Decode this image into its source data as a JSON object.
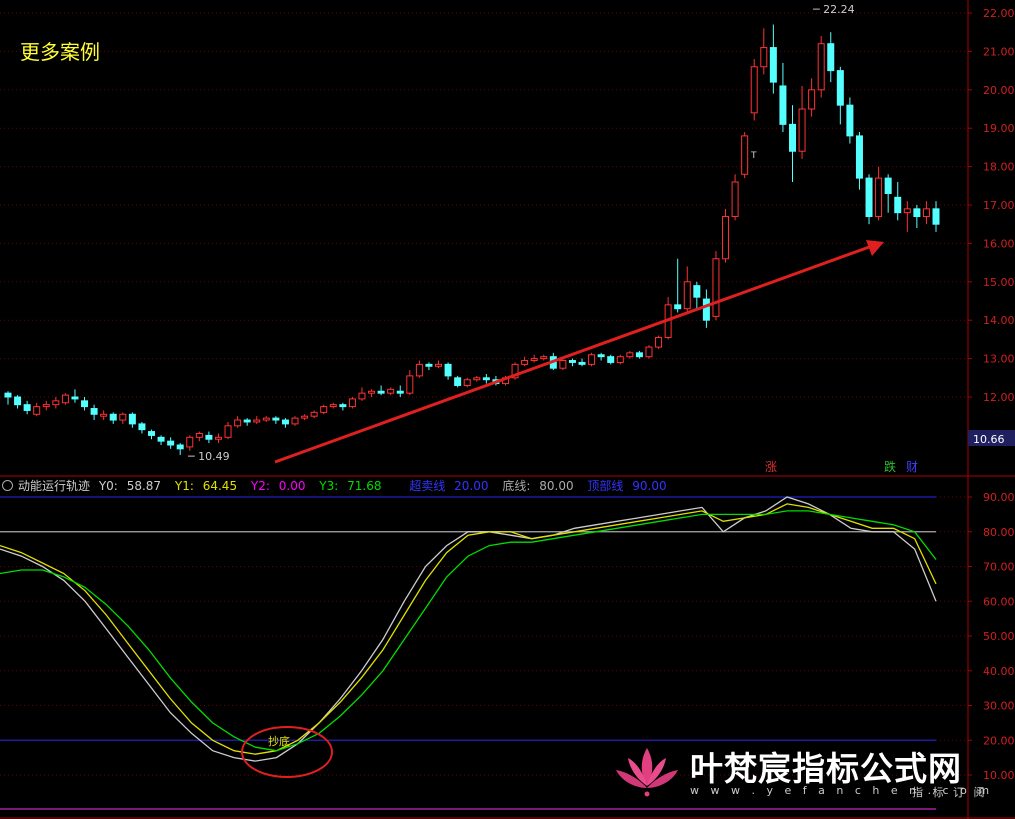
{
  "title": "更多案例",
  "chart_data": [
    {
      "type": "candlestick",
      "title": "",
      "ylim": [
        10.2,
        22.2
      ],
      "yticks": [
        "22.00",
        "21.00",
        "20.00",
        "19.00",
        "18.00",
        "17.00",
        "16.00",
        "15.00",
        "14.00",
        "13.00",
        "12.00"
      ],
      "last_price_label": "10.66",
      "annotations": {
        "high": "22.24",
        "low": "10.49",
        "event_t": "T"
      },
      "markers": [
        "涨",
        "跌",
        "财"
      ],
      "candles": [
        [
          12.1,
          12.0,
          12.15,
          11.8
        ],
        [
          12.0,
          11.8,
          12.05,
          11.7
        ],
        [
          11.8,
          11.65,
          11.9,
          11.55
        ],
        [
          11.55,
          11.75,
          11.85,
          11.5
        ],
        [
          11.75,
          11.8,
          11.9,
          11.65
        ],
        [
          11.8,
          11.9,
          12.0,
          11.7
        ],
        [
          11.85,
          12.05,
          12.1,
          11.8
        ],
        [
          12.0,
          11.95,
          12.2,
          11.85
        ],
        [
          11.9,
          11.75,
          12.0,
          11.65
        ],
        [
          11.7,
          11.55,
          11.8,
          11.4
        ],
        [
          11.5,
          11.55,
          11.65,
          11.4
        ],
        [
          11.55,
          11.4,
          11.6,
          11.3
        ],
        [
          11.4,
          11.55,
          11.6,
          11.3
        ],
        [
          11.55,
          11.3,
          11.6,
          11.2
        ],
        [
          11.3,
          11.15,
          11.35,
          11.05
        ],
        [
          11.1,
          11.0,
          11.15,
          10.9
        ],
        [
          10.95,
          10.85,
          11.0,
          10.75
        ],
        [
          10.85,
          10.75,
          10.95,
          10.65
        ],
        [
          10.75,
          10.65,
          10.8,
          10.49
        ],
        [
          10.7,
          10.95,
          11.0,
          10.6
        ],
        [
          10.95,
          11.05,
          11.1,
          10.85
        ],
        [
          11.0,
          10.9,
          11.1,
          10.8
        ],
        [
          10.9,
          10.95,
          11.05,
          10.8
        ],
        [
          10.95,
          11.25,
          11.35,
          10.9
        ],
        [
          11.25,
          11.4,
          11.5,
          11.2
        ],
        [
          11.4,
          11.35,
          11.45,
          11.25
        ],
        [
          11.35,
          11.4,
          11.5,
          11.3
        ],
        [
          11.4,
          11.45,
          11.5,
          11.35
        ],
        [
          11.45,
          11.4,
          11.5,
          11.3
        ],
        [
          11.4,
          11.3,
          11.45,
          11.2
        ],
        [
          11.3,
          11.45,
          11.5,
          11.25
        ],
        [
          11.45,
          11.5,
          11.55,
          11.4
        ],
        [
          11.5,
          11.6,
          11.65,
          11.45
        ],
        [
          11.6,
          11.75,
          11.8,
          11.55
        ],
        [
          11.75,
          11.8,
          11.85,
          11.7
        ],
        [
          11.8,
          11.75,
          11.85,
          11.65
        ],
        [
          11.75,
          11.95,
          12.0,
          11.7
        ],
        [
          11.95,
          12.1,
          12.25,
          11.9
        ],
        [
          12.1,
          12.15,
          12.2,
          12.0
        ],
        [
          12.15,
          12.1,
          12.3,
          12.05
        ],
        [
          12.1,
          12.2,
          12.25,
          12.05
        ],
        [
          12.15,
          12.1,
          12.3,
          12.0
        ],
        [
          12.1,
          12.55,
          12.7,
          12.05
        ],
        [
          12.55,
          12.85,
          12.95,
          12.5
        ],
        [
          12.85,
          12.8,
          12.9,
          12.7
        ],
        [
          12.8,
          12.85,
          12.95,
          12.75
        ],
        [
          12.85,
          12.55,
          12.9,
          12.45
        ],
        [
          12.5,
          12.3,
          12.55,
          12.25
        ],
        [
          12.3,
          12.45,
          12.5,
          12.25
        ],
        [
          12.45,
          12.5,
          12.55,
          12.4
        ],
        [
          12.5,
          12.45,
          12.6,
          12.35
        ],
        [
          12.45,
          12.35,
          12.55,
          12.3
        ],
        [
          12.35,
          12.5,
          12.55,
          12.3
        ],
        [
          12.5,
          12.85,
          12.9,
          12.45
        ],
        [
          12.85,
          12.95,
          13.05,
          12.8
        ],
        [
          12.95,
          13.0,
          13.1,
          12.9
        ],
        [
          13.0,
          13.05,
          13.1,
          12.95
        ],
        [
          13.05,
          12.75,
          13.15,
          12.7
        ],
        [
          12.75,
          12.95,
          13.05,
          12.7
        ],
        [
          12.95,
          12.9,
          13.0,
          12.8
        ],
        [
          12.9,
          12.85,
          13.0,
          12.8
        ],
        [
          12.85,
          13.1,
          13.15,
          12.8
        ],
        [
          13.1,
          13.05,
          13.15,
          12.95
        ],
        [
          13.05,
          12.9,
          13.1,
          12.85
        ],
        [
          12.9,
          13.05,
          13.1,
          12.85
        ],
        [
          13.05,
          13.15,
          13.2,
          13.0
        ],
        [
          13.15,
          13.05,
          13.2,
          13.0
        ],
        [
          13.05,
          13.3,
          13.35,
          13.0
        ],
        [
          13.3,
          13.55,
          13.6,
          13.25
        ],
        [
          13.55,
          14.4,
          14.6,
          13.5
        ],
        [
          14.4,
          14.3,
          15.6,
          14.2
        ],
        [
          14.3,
          15.0,
          15.4,
          14.2
        ],
        [
          14.9,
          14.6,
          15.0,
          14.3
        ],
        [
          14.55,
          14.0,
          14.8,
          13.8
        ],
        [
          14.1,
          15.6,
          15.8,
          14.0
        ],
        [
          15.6,
          16.7,
          16.9,
          15.5
        ],
        [
          16.7,
          17.6,
          17.8,
          16.6
        ],
        [
          17.8,
          18.8,
          18.9,
          17.7
        ],
        [
          19.4,
          20.6,
          20.8,
          19.2
        ],
        [
          20.6,
          21.1,
          21.6,
          20.4
        ],
        [
          21.1,
          20.2,
          21.7,
          19.9
        ],
        [
          20.1,
          19.1,
          20.7,
          18.9
        ],
        [
          19.1,
          18.4,
          19.6,
          17.6
        ],
        [
          18.4,
          19.5,
          20.1,
          18.2
        ],
        [
          19.5,
          20.0,
          20.3,
          19.3
        ],
        [
          20.0,
          21.2,
          21.4,
          19.8
        ],
        [
          21.2,
          20.5,
          21.5,
          20.2
        ],
        [
          20.5,
          19.6,
          20.6,
          19.1
        ],
        [
          19.6,
          18.8,
          19.8,
          18.6
        ],
        [
          18.8,
          17.7,
          18.9,
          17.4
        ],
        [
          17.7,
          16.7,
          17.8,
          16.5
        ],
        [
          16.7,
          17.7,
          18.0,
          16.6
        ],
        [
          17.7,
          17.3,
          17.8,
          16.8
        ],
        [
          17.2,
          16.8,
          17.6,
          16.6
        ],
        [
          16.8,
          16.9,
          17.1,
          16.3
        ],
        [
          16.9,
          16.7,
          17.0,
          16.4
        ],
        [
          16.7,
          16.9,
          17.1,
          16.5
        ],
        [
          16.9,
          16.5,
          17.1,
          16.3
        ]
      ]
    },
    {
      "type": "line",
      "title": "动能运行轨迹",
      "ylim": [
        0,
        95
      ],
      "yticks": [
        "90.00",
        "80.00",
        "70.00",
        "60.00",
        "50.00",
        "40.00",
        "30.00",
        "20.00",
        "10.00"
      ],
      "legend": [
        {
          "label": "Y0:",
          "value": "58.87",
          "color": "#cccccc"
        },
        {
          "label": "Y1:",
          "value": "64.45",
          "color": "#e0e000"
        },
        {
          "label": "Y2:",
          "value": "0.00",
          "color": "#ff00ff"
        },
        {
          "label": "Y3:",
          "value": "71.68",
          "color": "#00dd00"
        },
        {
          "label": "超卖线",
          "value": "20.00",
          "color": "#3333ff"
        },
        {
          "label": "底线:",
          "value": "80.00",
          "color": "#aaaaaa"
        },
        {
          "label": "顶部线",
          "value": "90.00",
          "color": "#3333ff"
        }
      ],
      "reference_lines": [
        90,
        80,
        20
      ],
      "annotation": "抄底",
      "series": [
        {
          "name": "Y0",
          "color": "#cccccc",
          "values": [
            75,
            73,
            70,
            66,
            60,
            52,
            44,
            36,
            28,
            22,
            17,
            15,
            14,
            15,
            19,
            25,
            32,
            40,
            49,
            60,
            70,
            76,
            80,
            80,
            79,
            78,
            79,
            81,
            82,
            83,
            84,
            85,
            86,
            87,
            80,
            84,
            86,
            90,
            88,
            85,
            81,
            80,
            80,
            75,
            60
          ]
        },
        {
          "name": "Y1",
          "color": "#e0e000",
          "values": [
            76,
            74,
            71,
            68,
            63,
            56,
            48,
            40,
            32,
            25,
            20,
            17,
            16,
            17,
            20,
            25,
            31,
            38,
            46,
            56,
            66,
            74,
            79,
            80,
            80,
            78,
            79,
            80,
            81,
            82,
            83,
            84,
            85,
            86,
            83,
            84,
            85,
            88,
            87,
            85,
            83,
            81,
            81,
            78,
            65
          ]
        },
        {
          "name": "Y3",
          "color": "#00dd00",
          "values": [
            68,
            69,
            69,
            67,
            64,
            59,
            53,
            46,
            38,
            31,
            25,
            21,
            18,
            17,
            19,
            22,
            27,
            33,
            40,
            49,
            58,
            67,
            73,
            76,
            77,
            77,
            78,
            79,
            80,
            81,
            82,
            83,
            84,
            85,
            85,
            85,
            85,
            86,
            86,
            85,
            84,
            83,
            82,
            80,
            72
          ]
        }
      ]
    }
  ],
  "brand": {
    "name": "叶梵宸指标公式网",
    "url": "w w w . y e f a n c h e n . c o m",
    "sub": "指 标 订 阅"
  }
}
